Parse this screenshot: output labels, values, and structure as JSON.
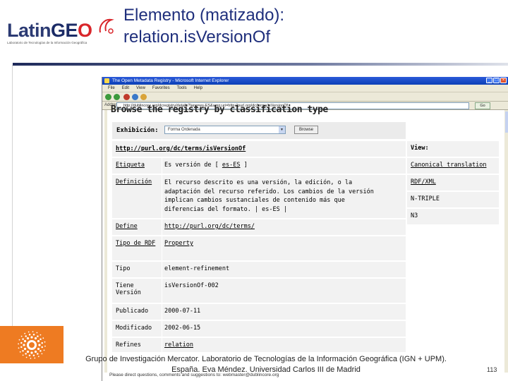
{
  "slide": {
    "title_line1": "Elemento (matizado):",
    "title_line2": "relation.isVersionOf",
    "logo": {
      "text_main": "Latin",
      "text_geo": "GE",
      "text_o": "O",
      "tagline": "Laboratorio de Tecnologías de la Información Geográfica"
    },
    "credits_line1": "Grupo de Investigación Mercator. Laboratorio de Tecnologías de la Información Geográfica (IGN + UPM).",
    "credits_line2": "España.  Eva Méndez. Universidad Carlos III de Madrid",
    "page_number": "113",
    "colors": {
      "title": "#1f2f7c",
      "accent_orange": "#ee7b22"
    }
  },
  "browser": {
    "window_title": "The Open Metadata Registry - Microsoft Internet Explorer",
    "menu": [
      "File",
      "Edit",
      "View",
      "Favorites",
      "Tools",
      "Help"
    ],
    "address_label": "Address",
    "address_url": "http://dublincore.org/dcregistry/details?lang=es-ES&amp;uri=http://purl.org/dc/terms/isVersionOf",
    "go_label": "Go",
    "page": {
      "heading": "Browse the registry by classification type",
      "exhibition_label": "Exhibición:",
      "exhibition_value": "Forma Ordenada",
      "browse_button": "Browse",
      "uri_header": "http://purl.org/dc/terms/isVersionOf",
      "rows": [
        {
          "key": "Etiqueta",
          "value": "Es versión de [",
          "value_link": "es-ES",
          "value_end": "]"
        },
        {
          "key": "Definición",
          "lines": [
            "El recurso descrito es una versión, la edición, o la",
            "adaptación del recurso referido. Los cambios de la versión",
            "implican cambios sustanciales de contenido más que",
            "diferencias del formato. | es-ES |"
          ]
        },
        {
          "key": "Define",
          "value": "http://purl.org/dc/terms/"
        },
        {
          "key": "Tipo de RDF",
          "value": "Property"
        },
        {
          "key": "Tipo",
          "value": "element-refinement"
        },
        {
          "key": "Tiene Versión",
          "value": "isVersionOf-002"
        },
        {
          "key": "Publicado",
          "value": "2000-07-11"
        },
        {
          "key": "Modificado",
          "value": "2002-06-15"
        },
        {
          "key": "Refines",
          "value": "relation"
        }
      ],
      "view": {
        "header": "View:",
        "items": [
          "Canonical translation",
          "RDF/XML",
          "N-TRIPLE",
          "N3"
        ]
      },
      "footer_text": "Please direct questions, comments and suggestions to: webmaster@dublincore.org"
    }
  }
}
